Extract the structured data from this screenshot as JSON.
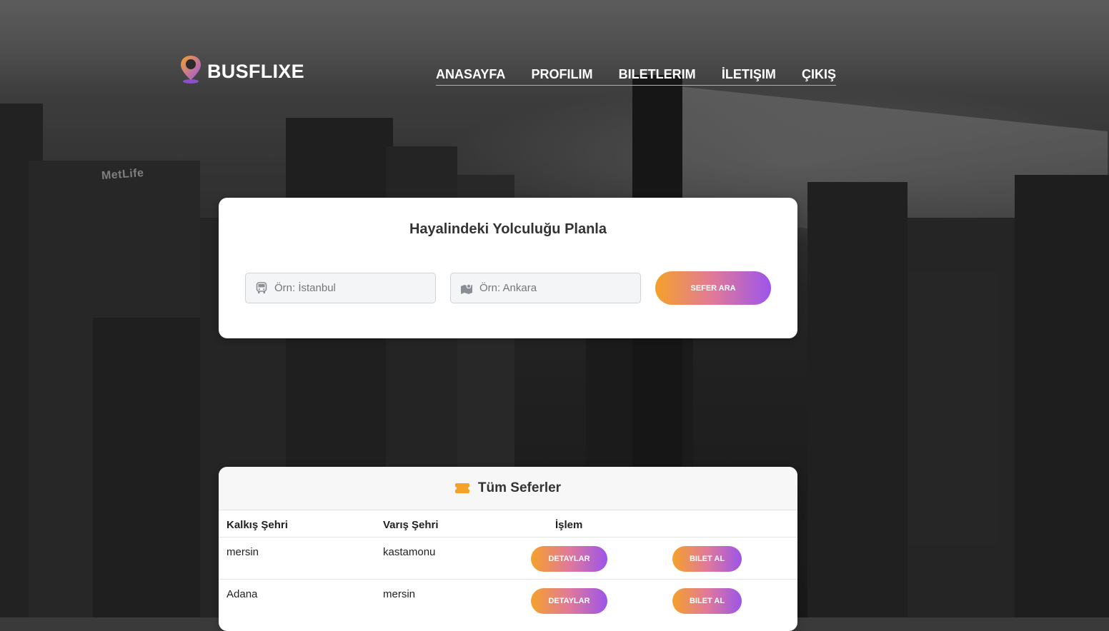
{
  "header": {
    "brand": "BUSFLIXE",
    "nav": [
      "ANASAYFA",
      "PROFILIM",
      "BILETLERIM",
      "İLETIŞIM",
      "ÇIKIŞ"
    ]
  },
  "background": {
    "sign_text": "MetLife"
  },
  "search": {
    "title": "Hayalindeki Yolculuğu Planla",
    "from_placeholder": "Örn: İstanbul",
    "to_placeholder": "Örn: Ankara",
    "button": "SEFER ARA"
  },
  "trips": {
    "title": "Tüm Seferler",
    "columns": [
      "Kalkış Şehri",
      "Varış Şehri",
      "İşlem"
    ],
    "rows": [
      {
        "from": "mersin",
        "to": "kastamonu",
        "details": "DETAYLAR",
        "buy": "BILET AL"
      },
      {
        "from": "Adana",
        "to": "mersin",
        "details": "DETAYLAR",
        "buy": "BILET AL"
      }
    ]
  },
  "colors": {
    "accent_orange": "#f5a12a",
    "accent_purple": "#9c55ea",
    "nav_underline": "#f0a050"
  }
}
